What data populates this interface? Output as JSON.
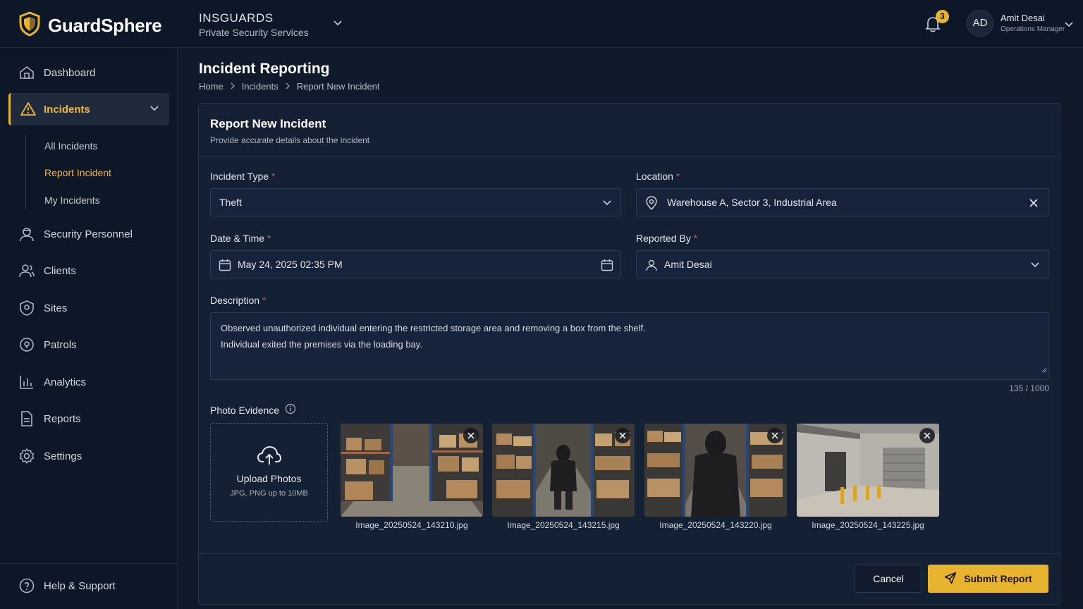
{
  "app": {
    "name": "GuardSphere"
  },
  "org": {
    "name": "INSGUARDS",
    "subtitle": "Private Security Services"
  },
  "notifications": {
    "count": "3"
  },
  "user": {
    "initials": "AD",
    "name": "Amit Desai",
    "role": "Operations Manager"
  },
  "sidebar": {
    "items": [
      {
        "label": "Dashboard",
        "icon": "home-icon"
      },
      {
        "label": "Incidents",
        "icon": "warning-icon"
      },
      {
        "label": "Security Personnel",
        "icon": "guard-icon"
      },
      {
        "label": "Clients",
        "icon": "users-icon"
      },
      {
        "label": "Sites",
        "icon": "site-icon"
      },
      {
        "label": "Patrols",
        "icon": "map-pin-icon"
      },
      {
        "label": "Analytics",
        "icon": "bar-chart-icon"
      },
      {
        "label": "Reports",
        "icon": "document-icon"
      },
      {
        "label": "Settings",
        "icon": "gear-icon"
      }
    ],
    "sub_items": [
      "All Incidents",
      "Report Incident",
      "My Incidents"
    ],
    "help": "Help & Support"
  },
  "page": {
    "title": "Incident Reporting",
    "breadcrumb": [
      "Home",
      "Incidents",
      "Report New Incident"
    ]
  },
  "form": {
    "title": "Report New Incident",
    "subtitle": "Provide accurate details about the incident",
    "incident_type": {
      "label": "Incident Type",
      "value": "Theft"
    },
    "location": {
      "label": "Location",
      "value": "Warehouse A, Sector 3, Industrial Area"
    },
    "datetime": {
      "label": "Date & Time",
      "value": "May 24, 2025 02:35 PM"
    },
    "reported_by": {
      "label": "Reported By",
      "value": "Amit Desai"
    },
    "description": {
      "label": "Description",
      "line1": "Observed unauthorized individual entering the restricted storage area and removing a box from the shelf.",
      "line2": "Individual exited the premises via the loading bay.",
      "counter": "135 / 1000"
    },
    "photos": {
      "label": "Photo Evidence",
      "upload_title": "Upload Photos",
      "upload_hint": "JPG, PNG up to 10MB",
      "files": [
        "Image_20250524_143210.jpg",
        "Image_20250524_143215.jpg",
        "Image_20250524_143220.jpg",
        "Image_20250524_143225.jpg"
      ]
    },
    "cancel": "Cancel",
    "submit": "Submit Report"
  },
  "colors": {
    "accent": "#e8b32f",
    "background": "#101a2b",
    "required": "#e5484d"
  }
}
